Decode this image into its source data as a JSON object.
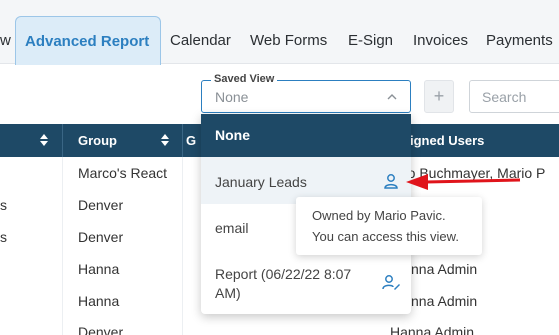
{
  "nav": {
    "tabs": [
      "w",
      "Advanced Report",
      "Calendar",
      "Web Forms",
      "E-Sign",
      "Invoices",
      "Payments"
    ],
    "active_index": 1
  },
  "saved_view": {
    "label": "Saved View",
    "value": "None"
  },
  "search": {
    "placeholder": "Search"
  },
  "plus_label": "+",
  "table": {
    "headers": [
      "Group",
      "G",
      "igned Users"
    ],
    "rows": [
      {
        "c1": "",
        "group": "Marco's React",
        "users": "rco Buchmayer,  Mario P"
      },
      {
        "c1": "s",
        "group": "Denver",
        "users": ""
      },
      {
        "c1": "s",
        "group": "Denver",
        "users": ""
      },
      {
        "c1": "",
        "group": "Hanna",
        "users": "nna Admin"
      },
      {
        "c1": "",
        "group": "Hanna",
        "users": "nna Admin"
      },
      {
        "c1": "",
        "group": "Denver",
        "users": "Hanna Admin"
      }
    ]
  },
  "dropdown": {
    "options": [
      {
        "label": "None",
        "icon": ""
      },
      {
        "label": "January Leads",
        "icon": "user-icon"
      },
      {
        "label": "email",
        "icon": ""
      },
      {
        "label": "Report (06/22/22 8:07",
        "label2": "AM)",
        "icon": "user-edit-icon"
      }
    ]
  },
  "tooltip": {
    "line1": "Owned by Mario Pavic.",
    "line2": "You can access this view."
  },
  "colors": {
    "header_bg": "#1e4966",
    "accent": "#2c7fc0",
    "arrow": "#e0141b"
  }
}
